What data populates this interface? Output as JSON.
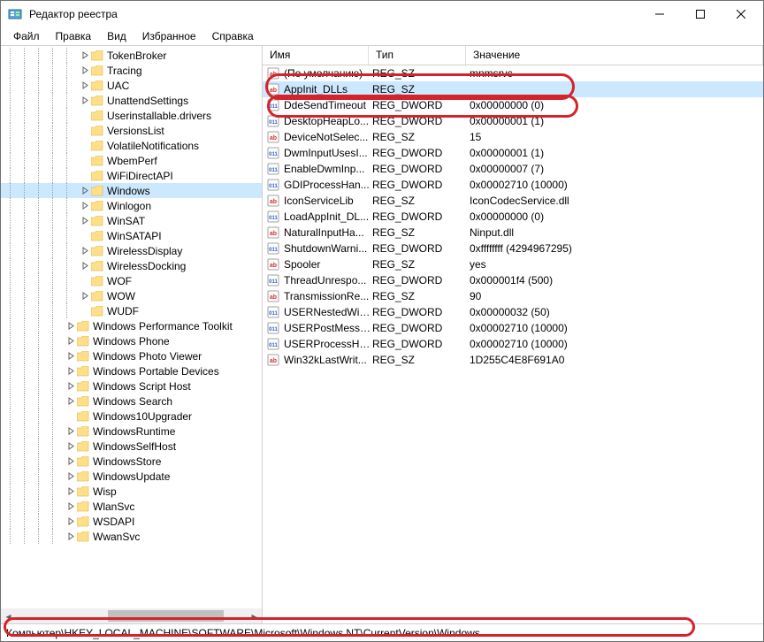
{
  "title": "Редактор реестра",
  "menu": {
    "file": "Файл",
    "edit": "Правка",
    "view": "Вид",
    "favorites": "Избранное",
    "help": "Справка"
  },
  "columns": {
    "name": "Имя",
    "type": "Тип",
    "value": "Значение"
  },
  "statusbar": "Компьютер\\HKEY_LOCAL_MACHINE\\SOFTWARE\\Microsoft\\Windows NT\\CurrentVersion\\Windows",
  "tree": [
    {
      "label": "TokenBroker",
      "depth": 7,
      "exp": "closed"
    },
    {
      "label": "Tracing",
      "depth": 7,
      "exp": "closed"
    },
    {
      "label": "UAC",
      "depth": 7,
      "exp": "closed"
    },
    {
      "label": "UnattendSettings",
      "depth": 7,
      "exp": "closed"
    },
    {
      "label": "Userinstallable.drivers",
      "depth": 7,
      "exp": "none"
    },
    {
      "label": "VersionsList",
      "depth": 7,
      "exp": "none"
    },
    {
      "label": "VolatileNotifications",
      "depth": 7,
      "exp": "none"
    },
    {
      "label": "WbemPerf",
      "depth": 7,
      "exp": "none"
    },
    {
      "label": "WiFiDirectAPI",
      "depth": 7,
      "exp": "none"
    },
    {
      "label": "Windows",
      "depth": 7,
      "exp": "closed",
      "selected": true
    },
    {
      "label": "Winlogon",
      "depth": 7,
      "exp": "closed"
    },
    {
      "label": "WinSAT",
      "depth": 7,
      "exp": "closed"
    },
    {
      "label": "WinSATAPI",
      "depth": 7,
      "exp": "none"
    },
    {
      "label": "WirelessDisplay",
      "depth": 7,
      "exp": "closed"
    },
    {
      "label": "WirelessDocking",
      "depth": 7,
      "exp": "closed"
    },
    {
      "label": "WOF",
      "depth": 7,
      "exp": "none"
    },
    {
      "label": "WOW",
      "depth": 7,
      "exp": "closed"
    },
    {
      "label": "WUDF",
      "depth": 7,
      "exp": "none"
    },
    {
      "label": "Windows Performance Toolkit",
      "depth": 6,
      "exp": "closed"
    },
    {
      "label": "Windows Phone",
      "depth": 6,
      "exp": "closed"
    },
    {
      "label": "Windows Photo Viewer",
      "depth": 6,
      "exp": "closed"
    },
    {
      "label": "Windows Portable Devices",
      "depth": 6,
      "exp": "closed"
    },
    {
      "label": "Windows Script Host",
      "depth": 6,
      "exp": "closed"
    },
    {
      "label": "Windows Search",
      "depth": 6,
      "exp": "closed"
    },
    {
      "label": "Windows10Upgrader",
      "depth": 6,
      "exp": "none"
    },
    {
      "label": "WindowsRuntime",
      "depth": 6,
      "exp": "closed"
    },
    {
      "label": "WindowsSelfHost",
      "depth": 6,
      "exp": "closed"
    },
    {
      "label": "WindowsStore",
      "depth": 6,
      "exp": "closed"
    },
    {
      "label": "WindowsUpdate",
      "depth": 6,
      "exp": "closed"
    },
    {
      "label": "Wisp",
      "depth": 6,
      "exp": "closed"
    },
    {
      "label": "WlanSvc",
      "depth": 6,
      "exp": "closed"
    },
    {
      "label": "WSDAPI",
      "depth": 6,
      "exp": "closed"
    },
    {
      "label": "WwanSvc",
      "depth": 6,
      "exp": "closed"
    }
  ],
  "values": [
    {
      "name": "(По умолчанию)",
      "type": "REG_SZ",
      "value": "mnmsrvc",
      "icon": "sz"
    },
    {
      "name": "AppInit_DLLs",
      "type": "REG_SZ",
      "value": "",
      "icon": "sz",
      "selected": true
    },
    {
      "name": "DdeSendTimeout",
      "type": "REG_DWORD",
      "value": "0x00000000 (0)",
      "icon": "dw"
    },
    {
      "name": "DesktopHeapLo...",
      "type": "REG_DWORD",
      "value": "0x00000001 (1)",
      "icon": "dw"
    },
    {
      "name": "DeviceNotSelec...",
      "type": "REG_SZ",
      "value": "15",
      "icon": "sz"
    },
    {
      "name": "DwmInputUsesI...",
      "type": "REG_DWORD",
      "value": "0x00000001 (1)",
      "icon": "dw"
    },
    {
      "name": "EnableDwmInp...",
      "type": "REG_DWORD",
      "value": "0x00000007 (7)",
      "icon": "dw"
    },
    {
      "name": "GDIProcessHan...",
      "type": "REG_DWORD",
      "value": "0x00002710 (10000)",
      "icon": "dw"
    },
    {
      "name": "IconServiceLib",
      "type": "REG_SZ",
      "value": "IconCodecService.dll",
      "icon": "sz"
    },
    {
      "name": "LoadAppInit_DL...",
      "type": "REG_DWORD",
      "value": "0x00000000 (0)",
      "icon": "dw"
    },
    {
      "name": "NaturalInputHa...",
      "type": "REG_SZ",
      "value": "Ninput.dll",
      "icon": "sz"
    },
    {
      "name": "ShutdownWarni...",
      "type": "REG_DWORD",
      "value": "0xffffffff (4294967295)",
      "icon": "dw"
    },
    {
      "name": "Spooler",
      "type": "REG_SZ",
      "value": "yes",
      "icon": "sz"
    },
    {
      "name": "ThreadUnrespo...",
      "type": "REG_DWORD",
      "value": "0x000001f4 (500)",
      "icon": "dw"
    },
    {
      "name": "TransmissionRe...",
      "type": "REG_SZ",
      "value": "90",
      "icon": "sz"
    },
    {
      "name": "USERNestedWin...",
      "type": "REG_DWORD",
      "value": "0x00000032 (50)",
      "icon": "dw"
    },
    {
      "name": "USERPostMessa...",
      "type": "REG_DWORD",
      "value": "0x00002710 (10000)",
      "icon": "dw"
    },
    {
      "name": "USERProcessHa...",
      "type": "REG_DWORD",
      "value": "0x00002710 (10000)",
      "icon": "dw"
    },
    {
      "name": "Win32kLastWrit...",
      "type": "REG_SZ",
      "value": "1D255C4E8F691A0",
      "icon": "sz"
    }
  ]
}
